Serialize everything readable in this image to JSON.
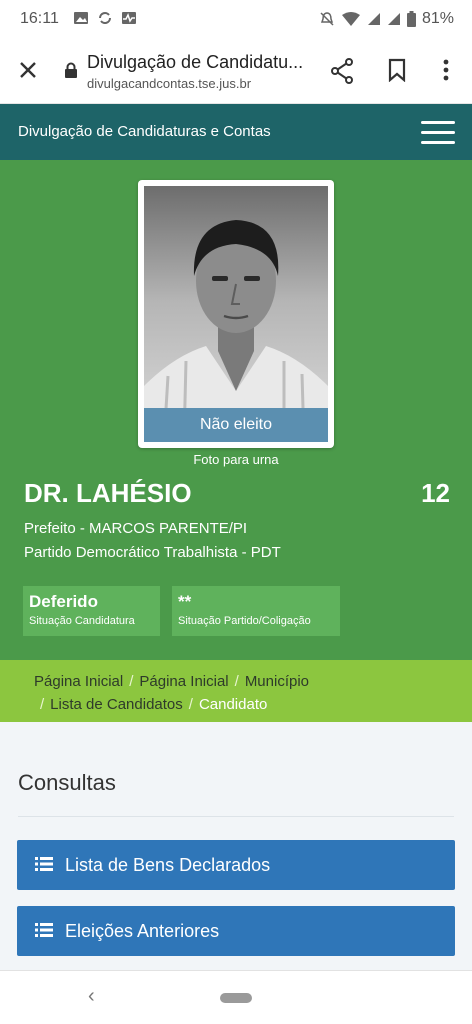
{
  "status_bar": {
    "time": "16:11",
    "battery": "81%"
  },
  "browser": {
    "page_title": "Divulgação de Candidatu...",
    "domain": "divulgacandcontas.tse.jus.br"
  },
  "site_header": {
    "brand": "Divulgação de Candidaturas e Contas"
  },
  "candidate": {
    "status_overlay": "Não eleito",
    "photo_caption": "Foto para urna",
    "name": "DR. LAHÉSIO",
    "number": "12",
    "office": "Prefeito - MARCOS PARENTE/PI",
    "party": "Partido Democrático Trabalhista - PDT",
    "badges": [
      {
        "value": "Deferido",
        "label": "Situação Candidatura"
      },
      {
        "value": "**",
        "label": "Situação Partido/Coligação"
      }
    ]
  },
  "breadcrumb": {
    "items": [
      "Página Inicial",
      "Página Inicial",
      "Município",
      "Lista de Candidatos"
    ],
    "current": "Candidato",
    "separator": "/"
  },
  "consultas": {
    "title": "Consultas",
    "buttons": [
      "Lista de Bens Declarados",
      "Eleições Anteriores"
    ]
  },
  "nav_bar": {
    "back_glyph": "‹"
  },
  "colors": {
    "header": "#1e6468",
    "candidate_bg": "#4b9a4a",
    "breadcrumb_bg": "#8cc63f",
    "button_blue": "#2f76b8"
  }
}
